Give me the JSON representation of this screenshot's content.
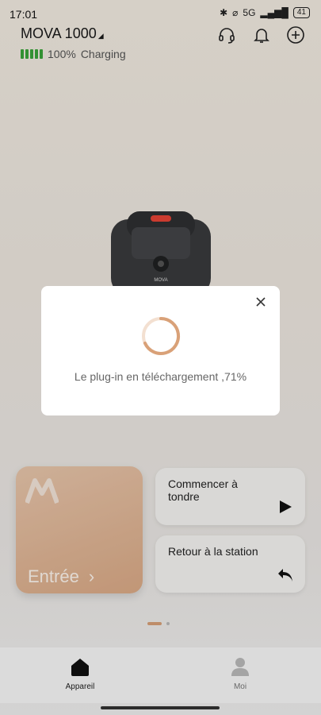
{
  "status": {
    "time": "17:01",
    "battery": "41",
    "network": "5G"
  },
  "header": {
    "device_name": "MOVA 1000",
    "battery_percent": "100%",
    "charge_status": "Charging",
    "battery_color": "#3ba53b"
  },
  "brand_mark": "MOVA",
  "cards": {
    "entree_label": "Entrée",
    "mow_label": "Commencer à tondre",
    "return_label": "Retour à la station"
  },
  "pager": {
    "active_index": 0,
    "count": 2
  },
  "nav": {
    "device_label": "Appareil",
    "me_label": "Moi"
  },
  "dialog": {
    "message": "Le plug-in en téléchargement ,71%",
    "progress_percent": 71
  },
  "colors": {
    "accent": "#d9a178"
  }
}
